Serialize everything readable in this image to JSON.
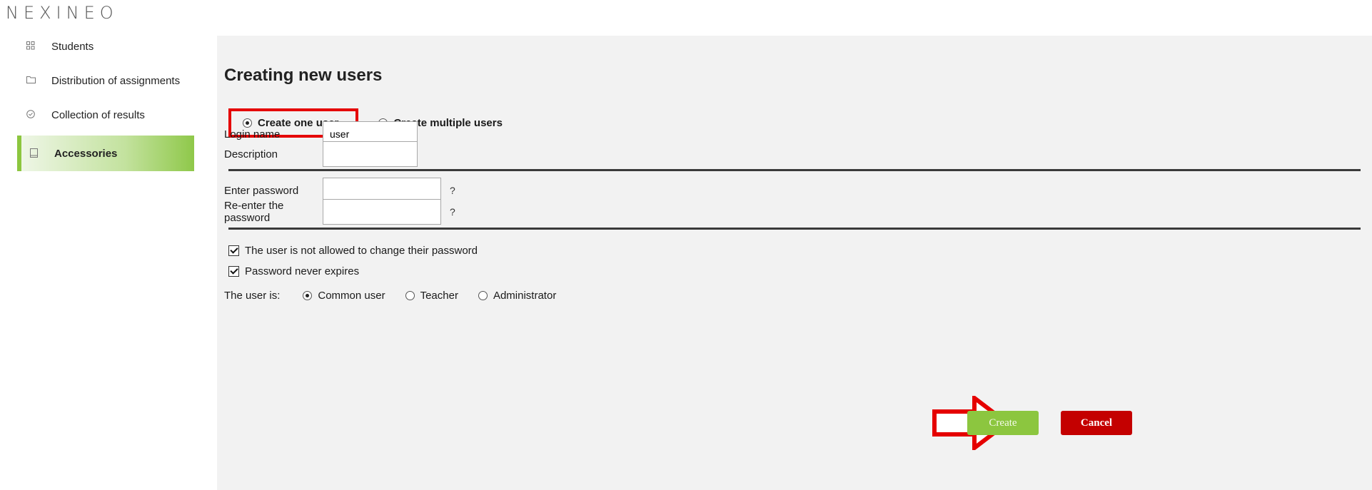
{
  "app": {
    "logo": "NEXINEO"
  },
  "sidebar": {
    "items": [
      {
        "label": "Students",
        "icon": "grid-icon"
      },
      {
        "label": "Distribution of assignments",
        "icon": "folder-icon"
      },
      {
        "label": "Collection of results",
        "icon": "check-circle-icon"
      },
      {
        "label": "Accessories",
        "icon": "book-icon",
        "active": true
      }
    ]
  },
  "main": {
    "title": "Creating new users",
    "mode": {
      "one_label": "Create one user",
      "multiple_label": "Create multiple users",
      "selected": "one"
    },
    "fields": {
      "login_label": "Login name",
      "login_value": "user",
      "description_label": "Description",
      "description_value": "",
      "password_label": "Enter password",
      "password_value": "",
      "reenter_label": "Re-enter the password",
      "reenter_value": "",
      "help": "?"
    },
    "options": {
      "no_change_label": "The user is not allowed to change their password",
      "no_change_checked": true,
      "never_expires_label": "Password never expires",
      "never_expires_checked": true
    },
    "role": {
      "label": "The user is:",
      "options": [
        "Common user",
        "Teacher",
        "Administrator"
      ],
      "selected": "Common user"
    },
    "buttons": {
      "create": "Create",
      "cancel": "Cancel"
    }
  },
  "colors": {
    "accent_green": "#8cc63f",
    "cancel_red": "#c40000",
    "highlight_red": "#e50000"
  }
}
